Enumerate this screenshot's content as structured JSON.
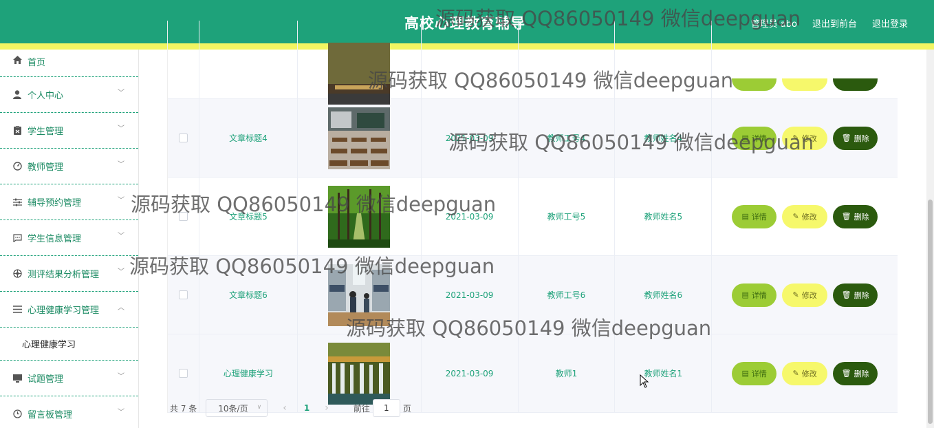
{
  "header": {
    "title": "高校心理教育辅导",
    "links": [
      "管理员 abo",
      "退出到前台",
      "退出登录"
    ]
  },
  "sidebar": {
    "items": [
      {
        "label": "首页",
        "icon": "home-icon",
        "chevron": false
      },
      {
        "label": "个人中心",
        "icon": "user-icon",
        "chevron": true
      },
      {
        "label": "学生管理",
        "icon": "id-card-icon",
        "chevron": true
      },
      {
        "label": "教师管理",
        "icon": "dashboard-icon",
        "chevron": true
      },
      {
        "label": "辅导预约管理",
        "icon": "sliders-icon",
        "chevron": true
      },
      {
        "label": "学生信息管理",
        "icon": "chat-icon",
        "chevron": true
      },
      {
        "label": "测评结果分析管理",
        "icon": "compass-icon",
        "chevron": true
      },
      {
        "label": "心理健康学习管理",
        "icon": "list-icon",
        "chevron": "up"
      },
      {
        "label": "试题管理",
        "icon": "monitor-icon",
        "chevron": true
      },
      {
        "label": "留言板管理",
        "icon": "clock-icon",
        "chevron": true
      }
    ],
    "submenu": "心理健康学习"
  },
  "table": {
    "rows": [
      {
        "title": "",
        "date": "",
        "teacher_no": "",
        "teacher_name": "",
        "image": "campus-photo",
        "alt": false
      },
      {
        "title": "文章标题4",
        "date": "2021-03-09",
        "teacher_no": "教师工号4",
        "teacher_name": "教师姓名4",
        "image": "classroom-photo",
        "alt": true
      },
      {
        "title": "文章标题5",
        "date": "2021-03-09",
        "teacher_no": "教师工号5",
        "teacher_name": "教师姓名5",
        "image": "forest-photo",
        "alt": false
      },
      {
        "title": "文章标题6",
        "date": "2021-03-09",
        "teacher_no": "教师工号6",
        "teacher_name": "教师姓名6",
        "image": "dorm-photo",
        "alt": true
      },
      {
        "title": "心理健康学习",
        "date": "2021-03-09",
        "teacher_no": "教师1",
        "teacher_name": "教师姓名1",
        "image": "waterfall-photo",
        "alt": true
      }
    ],
    "buttons": {
      "detail": "详情",
      "edit": "修改",
      "delete": "删除"
    }
  },
  "pager": {
    "total": "共 7 条",
    "page_size": "10条/页",
    "current_page": "1",
    "goto_prefix": "前往",
    "goto_value": "1",
    "goto_suffix": "页"
  },
  "watermark": "源码获取 QQ86050149 微信deepguan",
  "colors": {
    "primary": "#1ea27a",
    "stripe": "#f2f562",
    "detail_button": "#9ccc35",
    "edit_button": "#f6f86b",
    "delete_button": "#2b5a0e"
  }
}
